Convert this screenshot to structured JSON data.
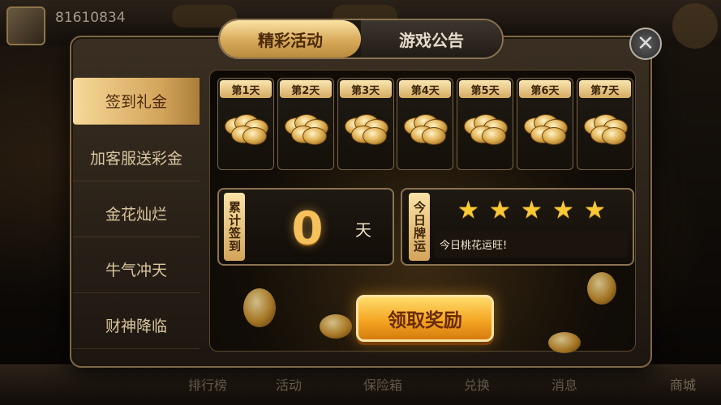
{
  "player": {
    "id": "81610834"
  },
  "tabs": [
    {
      "label": "精彩活动",
      "active": true
    },
    {
      "label": "游戏公告",
      "active": false
    }
  ],
  "sidebar": {
    "items": [
      {
        "label": "签到礼金",
        "active": true
      },
      {
        "label": "加客服送彩金",
        "active": false
      },
      {
        "label": "金花灿烂",
        "active": false
      },
      {
        "label": "牛气冲天",
        "active": false
      },
      {
        "label": "财神降临",
        "active": false
      }
    ]
  },
  "days": [
    {
      "label": "第1天"
    },
    {
      "label": "第2天"
    },
    {
      "label": "第3天"
    },
    {
      "label": "第4天"
    },
    {
      "label": "第5天"
    },
    {
      "label": "第6天"
    },
    {
      "label": "第7天"
    }
  ],
  "checkin": {
    "label": "累计签到",
    "count": "0",
    "unit": "天"
  },
  "fortune": {
    "label": "今日牌运",
    "stars": 5,
    "text": "今日桃花运旺!"
  },
  "claim_button": {
    "label": "领取奖励"
  },
  "bottom_nav": [
    "排行榜",
    "活动",
    "保险箱",
    "兑换",
    "消息",
    "商城"
  ],
  "colors": {
    "accent_gold": "#d7a958",
    "claim_orange": "#f5a623",
    "star_yellow": "#f8c935"
  }
}
